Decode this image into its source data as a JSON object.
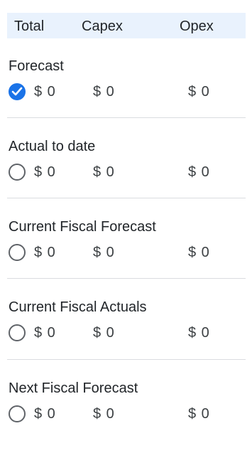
{
  "header": {
    "total": "Total",
    "capex": "Capex",
    "opex": "Opex"
  },
  "rows": [
    {
      "title": "Forecast",
      "selected": true,
      "total": "$ 0",
      "capex": "$ 0",
      "opex": "$ 0"
    },
    {
      "title": "Actual to date",
      "selected": false,
      "total": "$ 0",
      "capex": "$ 0",
      "opex": "$ 0"
    },
    {
      "title": "Current Fiscal Forecast",
      "selected": false,
      "total": "$ 0",
      "capex": "$ 0",
      "opex": "$ 0"
    },
    {
      "title": "Current Fiscal Actuals",
      "selected": false,
      "total": "$ 0",
      "capex": "$ 0",
      "opex": "$ 0"
    },
    {
      "title": "Next Fiscal Forecast",
      "selected": false,
      "total": "$ 0",
      "capex": "$ 0",
      "opex": "$ 0"
    }
  ],
  "colors": {
    "header_bg": "#e9f2fd",
    "accent": "#1a73e8",
    "divider": "#dadce0"
  }
}
